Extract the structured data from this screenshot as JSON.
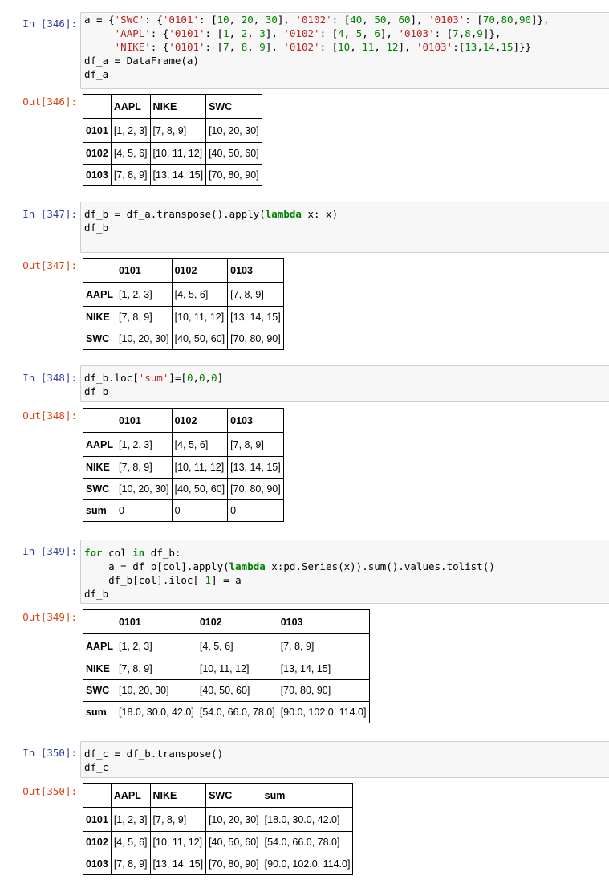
{
  "cells": [
    {
      "in_prompt": "In [346]:",
      "out_prompt": "Out[346]:",
      "code": [
        [
          [
            "a = {",
            ""
          ],
          [
            "'SWC'",
            "str"
          ],
          [
            ": {",
            ""
          ],
          [
            "'0101'",
            "str"
          ],
          [
            ": [",
            ""
          ],
          [
            "10",
            "num"
          ],
          [
            ", ",
            ""
          ],
          [
            "20",
            "num"
          ],
          [
            ", ",
            ""
          ],
          [
            "30",
            "num"
          ],
          [
            "], ",
            ""
          ],
          [
            "'0102'",
            "str"
          ],
          [
            ": [",
            ""
          ],
          [
            "40",
            "num"
          ],
          [
            ", ",
            ""
          ],
          [
            "50",
            "num"
          ],
          [
            ", ",
            ""
          ],
          [
            "60",
            "num"
          ],
          [
            "], ",
            ""
          ],
          [
            "'0103'",
            "str"
          ],
          [
            ": [",
            ""
          ],
          [
            "70",
            "num"
          ],
          [
            ",",
            ""
          ],
          [
            "80",
            "num"
          ],
          [
            ",",
            ""
          ],
          [
            "90",
            "num"
          ],
          [
            "]},",
            ""
          ]
        ],
        [
          [
            "     ",
            ""
          ],
          [
            "'AAPL'",
            "str"
          ],
          [
            ": {",
            ""
          ],
          [
            "'0101'",
            "str"
          ],
          [
            ": [",
            ""
          ],
          [
            "1",
            "num"
          ],
          [
            ", ",
            ""
          ],
          [
            "2",
            "num"
          ],
          [
            ", ",
            ""
          ],
          [
            "3",
            "num"
          ],
          [
            "], ",
            ""
          ],
          [
            "'0102'",
            "str"
          ],
          [
            ": [",
            ""
          ],
          [
            "4",
            "num"
          ],
          [
            ", ",
            ""
          ],
          [
            "5",
            "num"
          ],
          [
            ", ",
            ""
          ],
          [
            "6",
            "num"
          ],
          [
            "], ",
            ""
          ],
          [
            "'0103'",
            "str"
          ],
          [
            ": [",
            ""
          ],
          [
            "7",
            "num"
          ],
          [
            ",",
            ""
          ],
          [
            "8",
            "num"
          ],
          [
            ",",
            ""
          ],
          [
            "9",
            "num"
          ],
          [
            "]},",
            ""
          ]
        ],
        [
          [
            "     ",
            ""
          ],
          [
            "'NIKE'",
            "str"
          ],
          [
            ": {",
            ""
          ],
          [
            "'0101'",
            "str"
          ],
          [
            ": [",
            ""
          ],
          [
            "7",
            "num"
          ],
          [
            ", ",
            ""
          ],
          [
            "8",
            "num"
          ],
          [
            ", ",
            ""
          ],
          [
            "9",
            "num"
          ],
          [
            "], ",
            ""
          ],
          [
            "'0102'",
            "str"
          ],
          [
            ": [",
            ""
          ],
          [
            "10",
            "num"
          ],
          [
            ", ",
            ""
          ],
          [
            "11",
            "num"
          ],
          [
            ", ",
            ""
          ],
          [
            "12",
            "num"
          ],
          [
            "], ",
            ""
          ],
          [
            "'0103'",
            "str"
          ],
          [
            ":[",
            ""
          ],
          [
            "13",
            "num"
          ],
          [
            ",",
            ""
          ],
          [
            "14",
            "num"
          ],
          [
            ",",
            ""
          ],
          [
            "15",
            "num"
          ],
          [
            "]}}",
            ""
          ]
        ],
        [
          [
            "df_a = DataFrame(a)",
            ""
          ]
        ],
        [
          [
            "df_a",
            ""
          ]
        ]
      ],
      "table": {
        "columns": [
          "",
          "AAPL",
          "NIKE",
          "SWC"
        ],
        "rows": [
          {
            "index": "0101",
            "values": [
              "[1, 2, 3]",
              "[7, 8, 9]",
              "[10, 20, 30]"
            ]
          },
          {
            "index": "0102",
            "values": [
              "[4, 5, 6]",
              "[10, 11, 12]",
              "[40, 50, 60]"
            ]
          },
          {
            "index": "0103",
            "values": [
              "[7, 8, 9]",
              "[13, 14, 15]",
              "[70, 80, 90]"
            ]
          }
        ]
      }
    },
    {
      "in_prompt": "In [347]:",
      "out_prompt": "Out[347]:",
      "code": [
        [
          [
            "df_b = df_a.transpose().apply(",
            ""
          ],
          [
            "lambda",
            "kw"
          ],
          [
            " x: x)",
            ""
          ]
        ],
        [
          [
            "df_b",
            ""
          ]
        ]
      ],
      "table": {
        "columns": [
          "",
          "0101",
          "0102",
          "0103"
        ],
        "rows": [
          {
            "index": "AAPL",
            "values": [
              "[1, 2, 3]",
              "[4, 5, 6]",
              "[7, 8, 9]"
            ]
          },
          {
            "index": "NIKE",
            "values": [
              "[7, 8, 9]",
              "[10, 11, 12]",
              "[13, 14, 15]"
            ]
          },
          {
            "index": "SWC",
            "values": [
              "[10, 20, 30]",
              "[40, 50, 60]",
              "[70, 80, 90]"
            ]
          }
        ]
      }
    },
    {
      "in_prompt": "In [348]:",
      "out_prompt": "Out[348]:",
      "code": [
        [
          [
            "df_b.loc[",
            ""
          ],
          [
            "'sum'",
            "str"
          ],
          [
            "]=[",
            ""
          ],
          [
            "0",
            "num"
          ],
          [
            ",",
            ""
          ],
          [
            "0",
            "num"
          ],
          [
            ",",
            ""
          ],
          [
            "0",
            "num"
          ],
          [
            "]",
            ""
          ]
        ],
        [
          [
            "df_b",
            ""
          ]
        ]
      ],
      "table": {
        "columns": [
          "",
          "0101",
          "0102",
          "0103"
        ],
        "rows": [
          {
            "index": "AAPL",
            "values": [
              "[1, 2, 3]",
              "[4, 5, 6]",
              "[7, 8, 9]"
            ]
          },
          {
            "index": "NIKE",
            "values": [
              "[7, 8, 9]",
              "[10, 11, 12]",
              "[13, 14, 15]"
            ]
          },
          {
            "index": "SWC",
            "values": [
              "[10, 20, 30]",
              "[40, 50, 60]",
              "[70, 80, 90]"
            ]
          },
          {
            "index": "sum",
            "values": [
              "0",
              "0",
              "0"
            ]
          }
        ]
      }
    },
    {
      "in_prompt": "In [349]:",
      "out_prompt": "Out[349]:",
      "code": [
        [
          [
            "for",
            "kw"
          ],
          [
            " col ",
            ""
          ],
          [
            "in",
            "kw"
          ],
          [
            " df_b:",
            ""
          ]
        ],
        [
          [
            "    a = df_b[col].apply(",
            ""
          ],
          [
            "lambda",
            "kw"
          ],
          [
            " x:pd.Series(x)).sum().values.tolist()",
            ""
          ]
        ],
        [
          [
            "    df_b[col].iloc[",
            ""
          ],
          [
            "-",
            "op"
          ],
          [
            "1",
            "num"
          ],
          [
            "] = a",
            ""
          ]
        ],
        [
          [
            "df_b",
            ""
          ]
        ]
      ],
      "table": {
        "columns": [
          "",
          "0101",
          "0102",
          "0103"
        ],
        "rows": [
          {
            "index": "AAPL",
            "values": [
              "[1, 2, 3]",
              "[4, 5, 6]",
              "[7, 8, 9]"
            ]
          },
          {
            "index": "NIKE",
            "values": [
              "[7, 8, 9]",
              "[10, 11, 12]",
              "[13, 14, 15]"
            ]
          },
          {
            "index": "SWC",
            "values": [
              "[10, 20, 30]",
              "[40, 50, 60]",
              "[70, 80, 90]"
            ]
          },
          {
            "index": "sum",
            "values": [
              "[18.0, 30.0, 42.0]",
              "[54.0, 66.0, 78.0]",
              "[90.0, 102.0, 114.0]"
            ]
          }
        ]
      }
    },
    {
      "in_prompt": "In [350]:",
      "out_prompt": "Out[350]:",
      "code": [
        [
          [
            "df_c = df_b.transpose()",
            ""
          ]
        ],
        [
          [
            "df_c",
            ""
          ]
        ]
      ],
      "table": {
        "columns": [
          "",
          "AAPL",
          "NIKE",
          "SWC",
          "sum"
        ],
        "rows": [
          {
            "index": "0101",
            "values": [
              "[1, 2, 3]",
              "[7, 8, 9]",
              "[10, 20, 30]",
              "[18.0, 30.0, 42.0]"
            ]
          },
          {
            "index": "0102",
            "values": [
              "[4, 5, 6]",
              "[10, 11, 12]",
              "[40, 50, 60]",
              "[54.0, 66.0, 78.0]"
            ]
          },
          {
            "index": "0103",
            "values": [
              "[7, 8, 9]",
              "[13, 14, 15]",
              "[70, 80, 90]",
              "[90.0, 102.0, 114.0]"
            ]
          }
        ]
      }
    }
  ],
  "colors": {
    "in_prompt": "#303f9f",
    "out_prompt": "#d84315",
    "string": "#ba2121",
    "number": "#008000",
    "keyword": "#008000",
    "input_background": "#f7f7f7"
  }
}
